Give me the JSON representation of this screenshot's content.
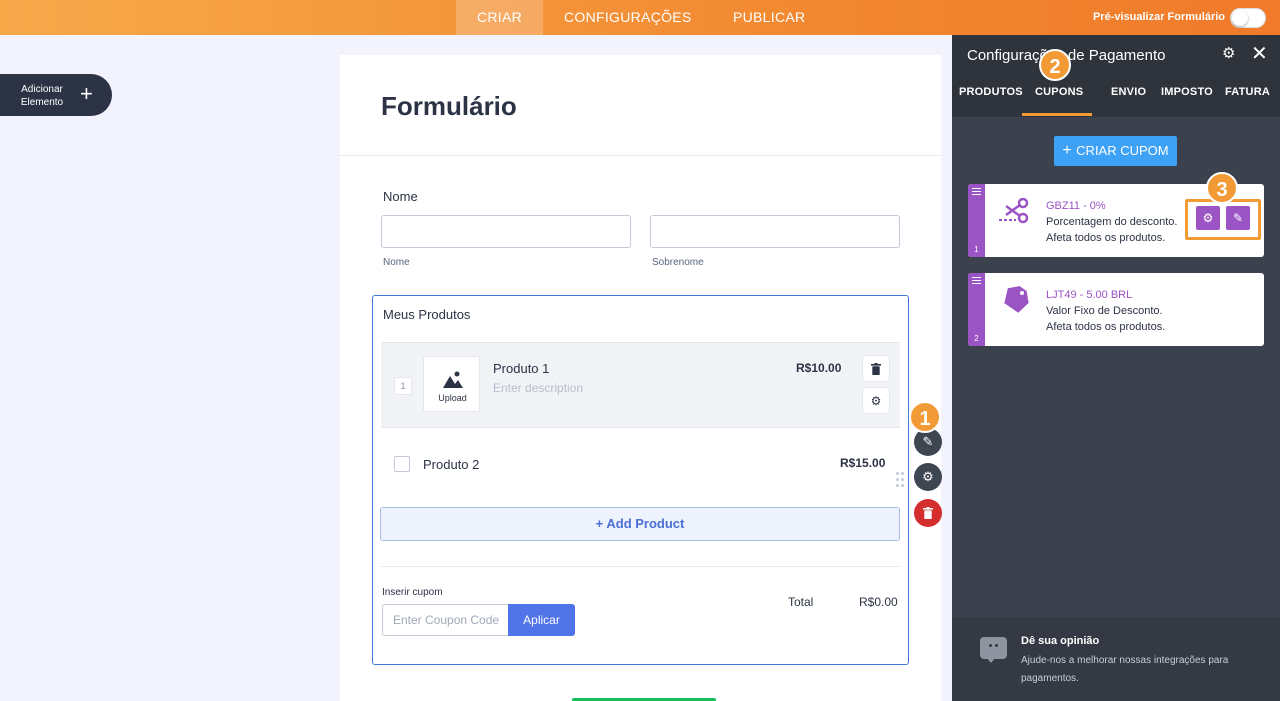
{
  "topbar": {
    "tabs": [
      "CRIAR",
      "CONFIGURAÇÕES",
      "PUBLICAR"
    ],
    "preview_label": "Pré-visualizar Formulário"
  },
  "add_element": {
    "label": "Adicionar Elemento",
    "icon": "plus-icon"
  },
  "form": {
    "title": "Formulário",
    "name_label": "Nome",
    "first_name_sublabel": "Nome",
    "last_name_sublabel": "Sobrenome",
    "products": {
      "title": "Meus Produtos",
      "items": [
        {
          "qty": "1",
          "name": "Produto 1",
          "description": "Enter description",
          "price": "R$10.00",
          "upload_label": "Upload"
        },
        {
          "name": "Produto 2",
          "price": "R$15.00"
        }
      ],
      "add_product_label": "+ Add Product",
      "coupon_label": "Inserir cupom",
      "coupon_placeholder": "Enter Coupon Code",
      "apply_label": "Aplicar",
      "total_label": "Total",
      "total_value": "R$0.00"
    }
  },
  "steps": [
    "1",
    "2",
    "3"
  ],
  "panel": {
    "title": "Configurações de Pagamento",
    "tabs": [
      "PRODUTOS",
      "CUPONS",
      "ENVIO",
      "IMPOSTO",
      "FATURA"
    ],
    "active_tab": "CUPONS",
    "create_coupon_label": "CRIAR CUPOM",
    "coupons": [
      {
        "index": "1",
        "name": "GBZ11 - 0%",
        "line1": "Porcentagem do desconto.",
        "line2": "Afeta todos os produtos.",
        "icon": "scissors-icon"
      },
      {
        "index": "2",
        "name": "LJT49 - 5.00 BRL",
        "line1": "Valor Fixo de Desconto.",
        "line2": "Afeta todos os produtos.",
        "icon": "tag-icon"
      }
    ],
    "feedback": {
      "title": "Dê sua opinião",
      "text": "Ajude-nos a melhorar nossas integrações para pagamentos."
    }
  },
  "colors": {
    "topbar_orange": "#f28a32",
    "panel_dark": "#3c424d",
    "coupon_purple": "#9b54c4",
    "create_blue": "#3da1f5",
    "step_orange": "#f29b36"
  }
}
